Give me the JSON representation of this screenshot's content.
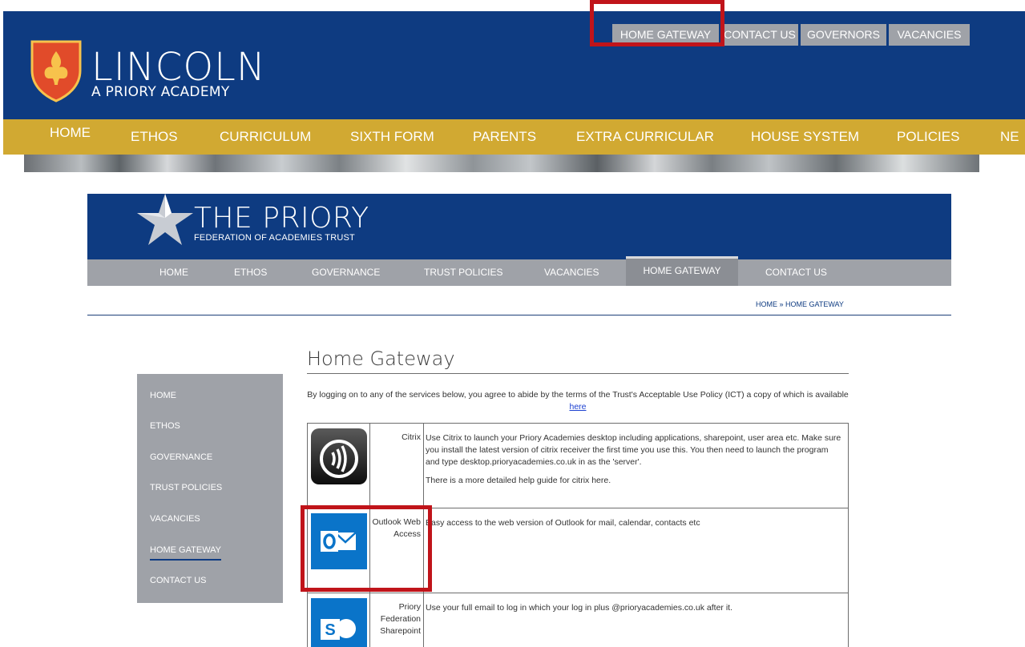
{
  "lincoln": {
    "title": "LINCOLN",
    "subtitle": "A PRIORY ACADEMY",
    "top_links": [
      "HOME GATEWAY",
      "CONTACT US",
      "GOVERNORS",
      "VACANCIES"
    ],
    "nav": [
      "HOME",
      "ETHOS",
      "CURRICULUM",
      "SIXTH FORM",
      "PARENTS",
      "EXTRA CURRICULAR",
      "HOUSE SYSTEM",
      "POLICIES",
      "NE"
    ]
  },
  "priory": {
    "title": "THE PRIORY",
    "subtitle": "FEDERATION OF ACADEMIES TRUST",
    "nav": [
      "HOME",
      "ETHOS",
      "GOVERNANCE",
      "TRUST POLICIES",
      "VACANCIES",
      "HOME GATEWAY",
      "CONTACT US"
    ],
    "breadcrumb": "HOME » HOME GATEWAY"
  },
  "side_menu": [
    "HOME",
    "ETHOS",
    "GOVERNANCE",
    "TRUST POLICIES",
    "VACANCIES",
    "HOME GATEWAY",
    "CONTACT US"
  ],
  "content": {
    "title": "Home Gateway",
    "intro_text": "By logging on to any of the services below, you agree to abide by the terms of the Trust's Acceptable Use Policy (ICT) a copy of which is available",
    "intro_link": "here",
    "services": [
      {
        "name": "Citrix",
        "desc_before": "Use Citrix to launch your Priory Academies desktop including applications, sharepoint, user area etc. Make sure you install the latest version of",
        "desc_link": "citrix receiver",
        "desc_after": "the first time you use this. You then need to launch the program and type desktop.prioryacademies.co.uk in as the 'server'.",
        "help_before": "There is a more detailed",
        "help_link": "help guide for citrix here",
        "help_after": "."
      },
      {
        "name": "Outlook Web Access",
        "desc": "Easy access to the web version of Outlook for mail, calendar, contacts etc"
      },
      {
        "name": "Priory Federation Sharepoint",
        "desc": "Use your full email to log in which your log in plus @prioryacademies.co.uk after it."
      }
    ]
  },
  "colors": {
    "navy": "#0e3b81",
    "gold": "#d1a932",
    "grey_nav": "#9fa2a8",
    "highlight": "#c0141a"
  }
}
